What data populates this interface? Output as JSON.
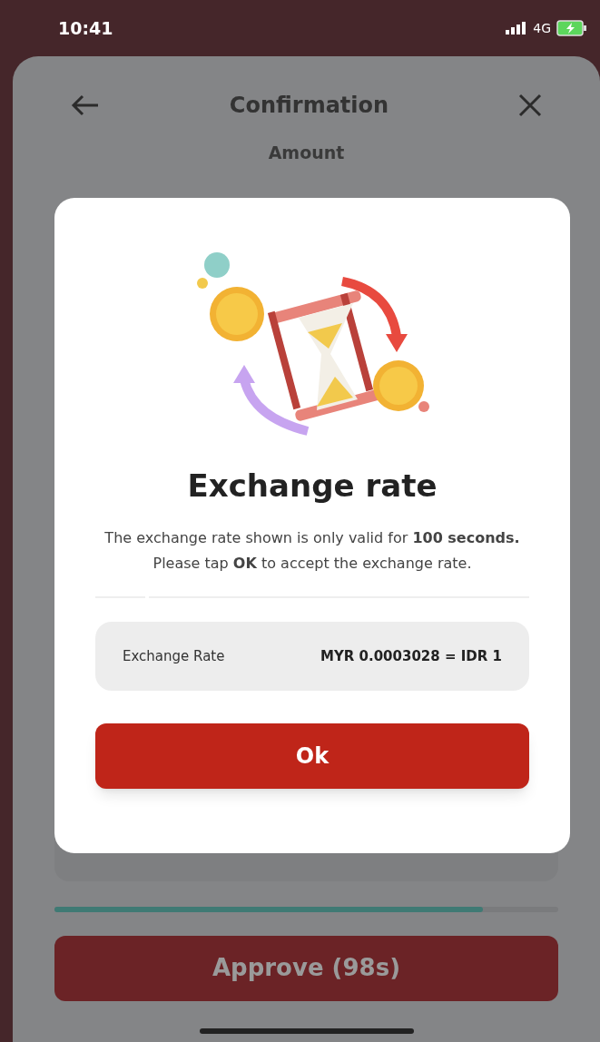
{
  "status_bar": {
    "time": "10:41",
    "network": "4G"
  },
  "header": {
    "title": "Confirmation"
  },
  "amount": {
    "label": "Amount"
  },
  "dialog": {
    "title": "Exchange rate",
    "message": "The exchange rate shown is only valid for **100 seconds.**",
    "instruction": "Please tap **OK** to accept the exchange rate.",
    "rate": {
      "label": "Exchange Rate",
      "value": "MYR 0.0003028 = IDR 1"
    },
    "button": "Ok"
  },
  "timer": {
    "level": 0.85
  },
  "approve_button": {
    "label": "Approve (98s)",
    "disabled": true
  }
}
